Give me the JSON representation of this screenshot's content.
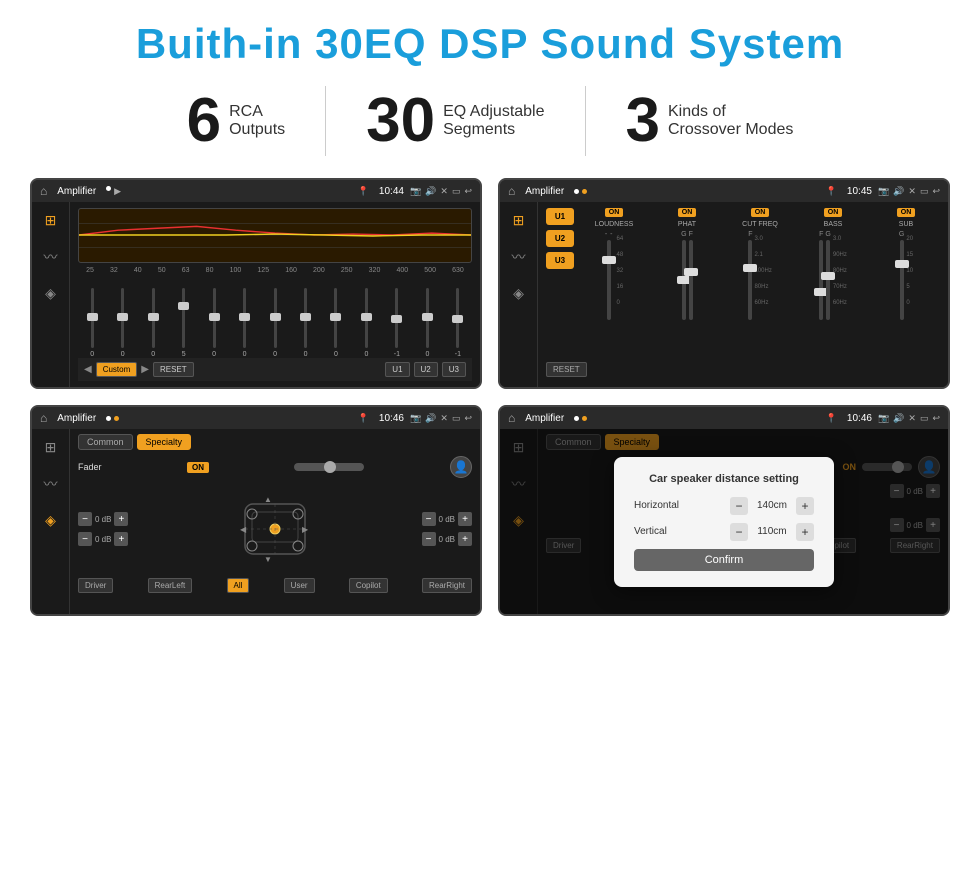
{
  "title": "Buith-in 30EQ DSP Sound System",
  "stats": [
    {
      "number": "6",
      "text_line1": "RCA",
      "text_line2": "Outputs"
    },
    {
      "number": "30",
      "text_line1": "EQ Adjustable",
      "text_line2": "Segments"
    },
    {
      "number": "3",
      "text_line1": "Kinds of",
      "text_line2": "Crossover Modes"
    }
  ],
  "screens": [
    {
      "id": "eq-screen",
      "status_title": "Amplifier",
      "status_mode": "▶",
      "status_time": "10:44",
      "type": "eq",
      "eq_freqs": [
        "25",
        "32",
        "40",
        "50",
        "63",
        "80",
        "100",
        "125",
        "160",
        "200",
        "250",
        "320",
        "400",
        "500",
        "630"
      ],
      "eq_values": [
        "0",
        "0",
        "0",
        "5",
        "0",
        "0",
        "0",
        "0",
        "0",
        "0",
        "-1",
        "0",
        "-1"
      ],
      "eq_preset": "Custom",
      "eq_buttons": [
        "U1",
        "U2",
        "U3"
      ]
    },
    {
      "id": "crossover-screen",
      "status_title": "Amplifier",
      "status_time": "10:45",
      "type": "crossover",
      "presets": [
        "U1",
        "U2",
        "U3"
      ],
      "channels": [
        {
          "label": "LOUDNESS",
          "on": true,
          "values": [
            "64",
            "48",
            "32",
            "16",
            "0"
          ]
        },
        {
          "label": "PHAT",
          "on": true,
          "values": [
            "G",
            "F"
          ]
        },
        {
          "label": "CUT FREQ",
          "on": true,
          "freq_vals": [
            "3.0",
            "2.1",
            "100Hz",
            "80Hz",
            "60Hz"
          ]
        },
        {
          "label": "BASS",
          "on": true,
          "freq_vals": [
            "F",
            "G",
            "3.0",
            "90Hz",
            "80Hz",
            "70Hz",
            "60Hz"
          ]
        },
        {
          "label": "SUB",
          "on": true,
          "values": [
            "G",
            "20",
            "15",
            "10",
            "5",
            "0"
          ]
        }
      ]
    },
    {
      "id": "speaker-screen",
      "status_title": "Amplifier",
      "status_time": "10:46",
      "type": "speaker",
      "tabs": [
        "Common",
        "Specialty"
      ],
      "active_tab": "Specialty",
      "fader_label": "Fader",
      "fader_on": true,
      "vol_controls": [
        {
          "label": "0 dB",
          "side": "left"
        },
        {
          "label": "0 dB",
          "side": "left"
        },
        {
          "label": "0 dB",
          "side": "right"
        },
        {
          "label": "0 dB",
          "side": "right"
        }
      ],
      "bottom_btns": [
        "Driver",
        "RearLeft",
        "All",
        "User",
        "Copilot",
        "RearRight"
      ]
    },
    {
      "id": "dialog-screen",
      "status_title": "Amplifier",
      "status_time": "10:46",
      "type": "speaker-dialog",
      "tabs": [
        "Common",
        "Specialty"
      ],
      "dialog_title": "Car speaker distance setting",
      "dialog_fields": [
        {
          "label": "Horizontal",
          "value": "140cm"
        },
        {
          "label": "Vertical",
          "value": "110cm"
        }
      ],
      "confirm_label": "Confirm",
      "vol_right1": "0 dB",
      "vol_right2": "0 dB",
      "bottom_btns_right": [
        "Copilot",
        "RearRight"
      ]
    }
  ]
}
